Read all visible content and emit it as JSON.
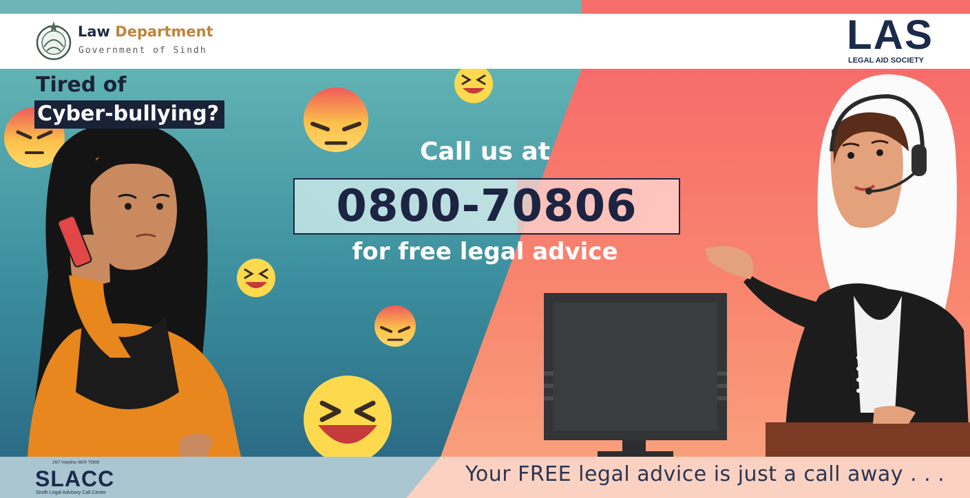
{
  "header": {
    "department_prefix": "Law",
    "department_accent": "Department",
    "government": "Government of Sindh",
    "las_logo": "LAS",
    "las_tagline": "LEGAL AID SOCIETY"
  },
  "headline": {
    "line1": "Tired of",
    "line2": "Cyber-bullying?"
  },
  "cta": {
    "call_us": "Call us at",
    "phone": "0800-70806",
    "subtext": "for free legal advice"
  },
  "footer": {
    "slacc_helpline": "24/7 Helpline 0800 70806",
    "slacc_logo": "SLACC",
    "slacc_tagline": "Sindh Legal Advisory Call Center",
    "tagline": "Your FREE legal advice is just a call away . . ."
  },
  "icons": [
    "sindh-seal-icon",
    "angry-emoji-icon",
    "laughing-emoji-icon",
    "phone-icon",
    "headset-icon",
    "computer-monitor-icon",
    "scales-icon"
  ],
  "colors": {
    "teal": "#6db4b6",
    "coral": "#f56e6c",
    "navy": "#1c2442",
    "orange_shirt": "#e8871e"
  }
}
